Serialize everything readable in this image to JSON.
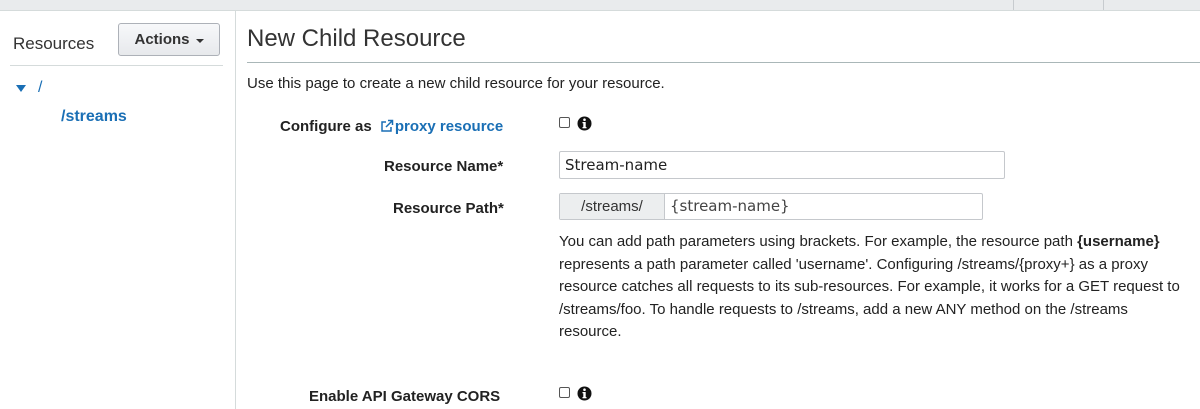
{
  "sidebar": {
    "title": "Resources",
    "actions_label": "Actions",
    "tree": {
      "root": "/",
      "child": "/streams"
    }
  },
  "main": {
    "title": "New Child Resource",
    "intro": "Use this page to create a new child resource for your resource.",
    "configure": {
      "prefix": "Configure as",
      "link": "proxy resource",
      "checked": false
    },
    "resource_name": {
      "label": "Resource Name*",
      "value": "Stream-name"
    },
    "resource_path": {
      "label": "Resource Path*",
      "prefix": "/streams/",
      "value": "{stream-name}"
    },
    "help": {
      "before": "You can add path parameters using brackets. For example, the resource path ",
      "bold": "{username}",
      "after": " represents a path parameter called 'username'. Configuring /streams/{proxy+} as a proxy resource catches all requests to its sub-resources. For example, it works for a GET request to /streams/foo. To handle requests to /streams, add a new ANY method on the /streams resource."
    },
    "cors": {
      "label": "Enable API Gateway CORS",
      "checked": false
    }
  },
  "colors": {
    "link": "#1a6fb5",
    "divider": "#d5dbdb"
  },
  "icons": [
    "external-link-icon",
    "info-icon",
    "caret-down-icon",
    "tree-expand-icon"
  ]
}
